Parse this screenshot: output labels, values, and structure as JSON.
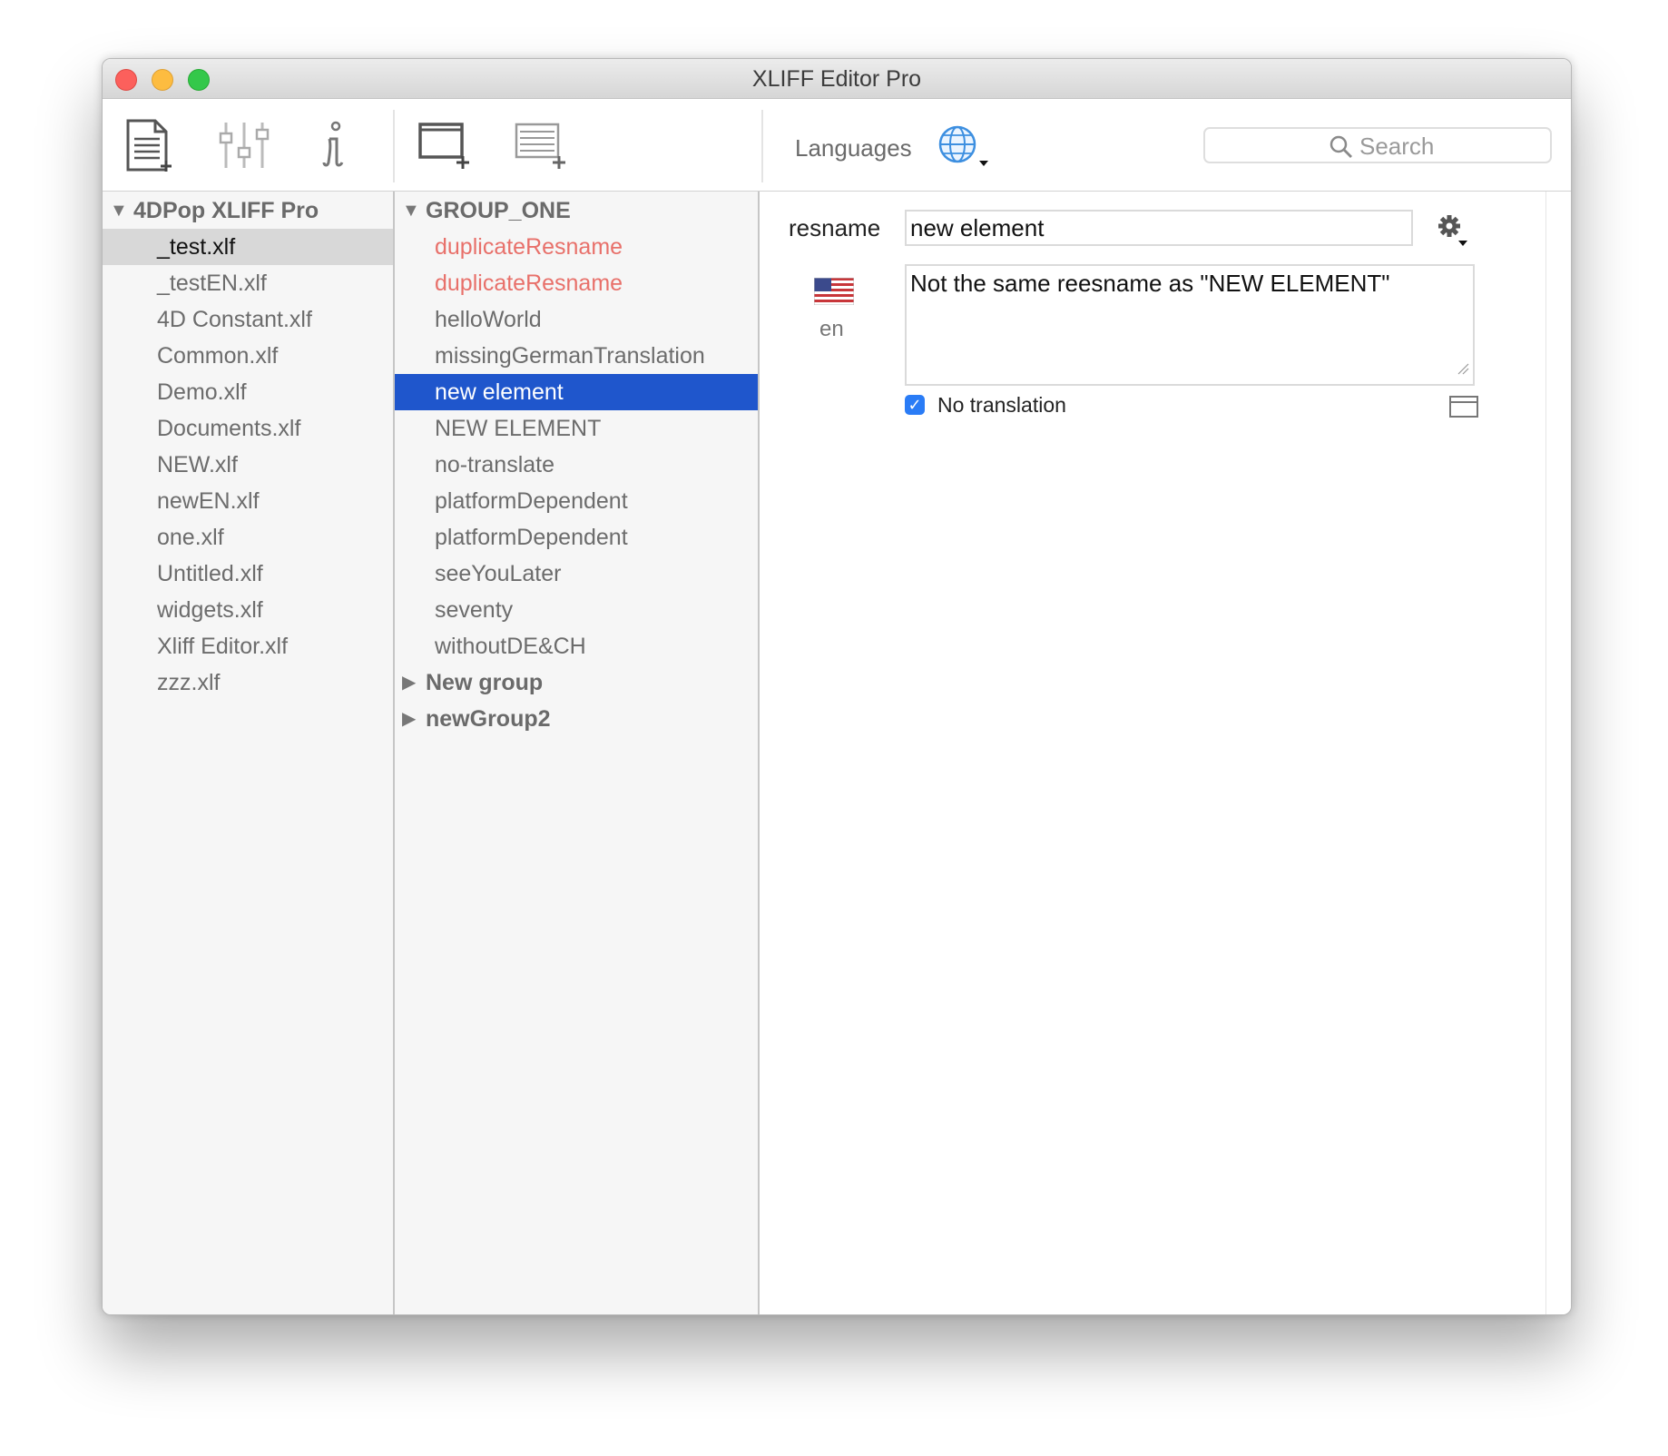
{
  "window": {
    "title": "XLIFF Editor Pro"
  },
  "toolbar": {
    "icons": [
      "new-file-icon",
      "settings-sliders-icon",
      "info-icon",
      "new-group-icon",
      "new-unit-icon",
      "globe-icon"
    ],
    "languages_label": "Languages",
    "search_placeholder": "Search"
  },
  "files_pane": {
    "project": "4DPop XLIFF Pro",
    "selected": "_test.xlf",
    "files": [
      "_test.xlf",
      "_testEN.xlf",
      "4D Constant.xlf",
      "Common.xlf",
      "Demo.xlf",
      "Documents.xlf",
      "NEW.xlf",
      "newEN.xlf",
      "one.xlf",
      "Untitled.xlf",
      "widgets.xlf",
      "Xliff Editor.xlf",
      "zzz.xlf"
    ]
  },
  "units_pane": {
    "group": "GROUP_ONE",
    "selected": "new element",
    "units": [
      "duplicateResname",
      "duplicateResname",
      "helloWorld",
      "missingGermanTranslation",
      "new element",
      "NEW ELEMENT",
      "no-translate",
      "platformDependent",
      "platformDependent",
      "seeYouLater",
      "seventy",
      "withoutDE&CH"
    ],
    "collapsed_groups": [
      "New group",
      "newGroup2"
    ]
  },
  "detail": {
    "resname_label": "resname",
    "resname_value": "new element",
    "language_code": "en",
    "translation_text": "Not the same reesname as \"NEW ELEMENT\"",
    "no_translation_label": "No translation",
    "no_translation_checked": true
  },
  "colors": {
    "selection_blue": "#1f56cc",
    "duplicate_red": "#e8706a",
    "checkbox_blue": "#2a7cf6"
  }
}
